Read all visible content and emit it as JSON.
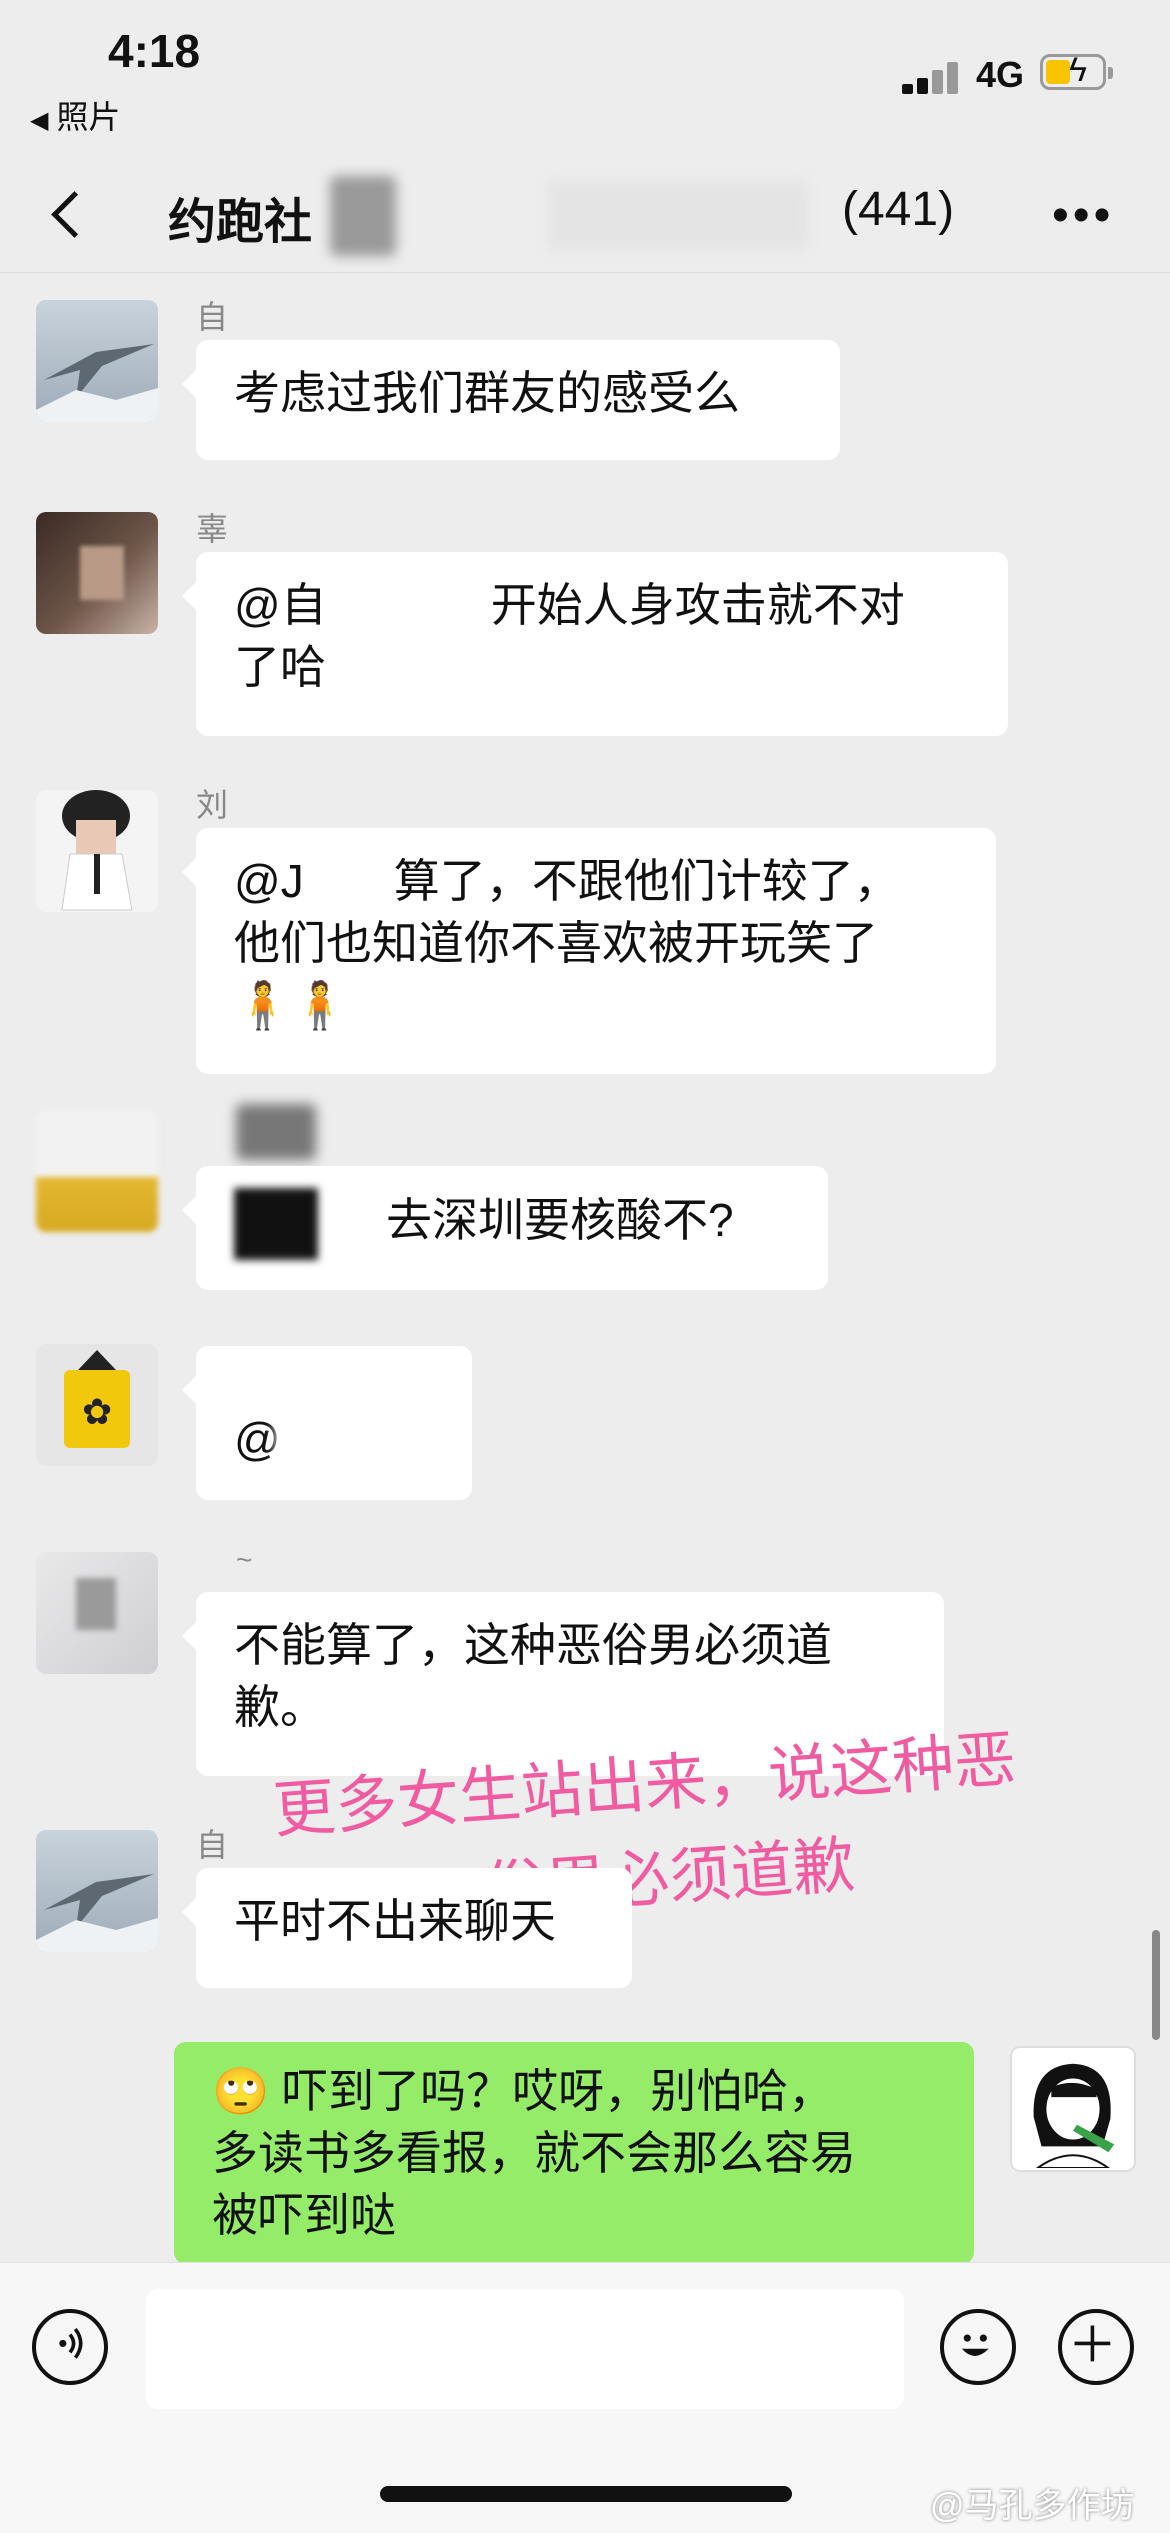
{
  "status_bar": {
    "time": "4:18",
    "back_app": "照片",
    "network": "4G"
  },
  "nav": {
    "title": "约跑社",
    "member_count": "(441)",
    "more": "•••"
  },
  "messages": [
    {
      "nick": "自",
      "text": "考虑过我们群友的感受么"
    },
    {
      "nick": "辜",
      "text_line1_a": "@自",
      "text_line1_b": "开始人身攻击就不对",
      "text_line2": "了哈"
    },
    {
      "nick": "刘",
      "text_line1_a": "@J",
      "text_line1_b": "算了，不跟他们计较了，",
      "text_line2": "他们也知道你不喜欢被开玩笑了",
      "emoji": "🧍🧍"
    },
    {
      "nick": "",
      "text": "去深圳要核酸不?"
    },
    {
      "nick": "",
      "text": "@"
    },
    {
      "nick": "~",
      "text_line1": "不能算了，这种恶俗男必须道",
      "text_line2": "歉。"
    },
    {
      "nick": "自",
      "text": "平时不出来聊天"
    }
  ],
  "my_message": {
    "emoji": "🙄",
    "line1": "吓到了吗？哎呀，别怕哈，",
    "line2": "多读书多看报，就不会那么容易",
    "line3": "被吓到哒"
  },
  "overlay": {
    "line1": "更多女生站出来，说这种恶",
    "line2": "俗男必须道歉"
  },
  "input": {
    "value": "",
    "placeholder": ""
  },
  "watermark": "@马孔多作坊"
}
